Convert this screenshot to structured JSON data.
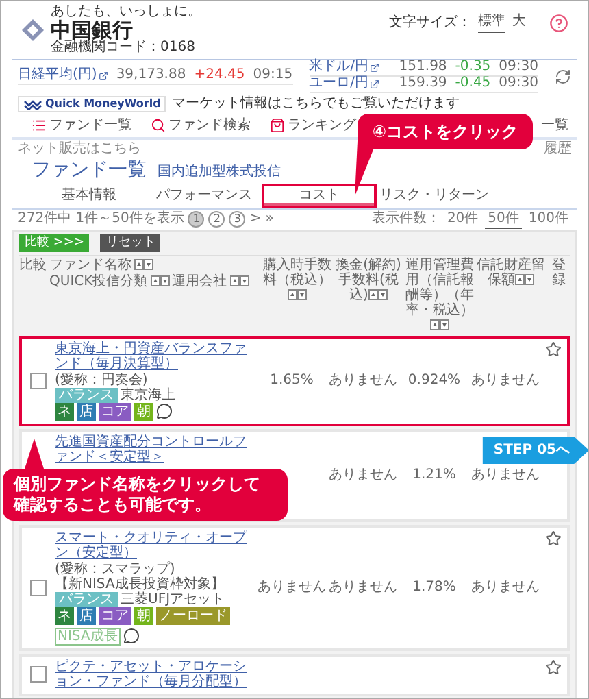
{
  "header": {
    "slogan": "あしたも、いっしょに。",
    "bank_name": "中国銀行",
    "bank_code": "金融機関コード：0168",
    "font_size_label": "文字サイズ：",
    "font_sizes": [
      {
        "label": "標準",
        "selected": true
      },
      {
        "label": "大",
        "selected": false
      }
    ]
  },
  "market": {
    "left": [
      {
        "name": "日経平均(円)",
        "value": "39,173.88",
        "change": "+24.45",
        "color": "#e53935",
        "time": "09:15"
      }
    ],
    "right": [
      {
        "name": "米ドル/円",
        "value": "151.98",
        "change": "-0.35",
        "color": "#3aa845",
        "time": "09:30"
      },
      {
        "name": "ユーロ/円",
        "value": "159.39",
        "change": "-0.45",
        "color": "#3aa845",
        "time": "09:30"
      }
    ]
  },
  "quick_banner": {
    "logo": "Quick MoneyWorld",
    "text": "マーケット情報はこちらでもご覧いただけます"
  },
  "nav": [
    {
      "kind": "list",
      "label": "ファンド一覧"
    },
    {
      "kind": "search",
      "label": "ファンド検索"
    },
    {
      "kind": "ranking",
      "label": "ランキング"
    },
    {
      "kind": "plain",
      "label": "一覧"
    }
  ],
  "breadcrumb": {
    "left": "ネット販売はこちら",
    "right": "履歴"
  },
  "title": {
    "main": "ファンド一覧",
    "sub": "国内追加型株式投信"
  },
  "tabs": [
    {
      "label": "基本情報",
      "selected": false,
      "highlighted": false
    },
    {
      "label": "パフォーマンス",
      "selected": false,
      "highlighted": false
    },
    {
      "label": "コスト",
      "selected": true,
      "highlighted": true
    },
    {
      "label": "リスク・リターン",
      "selected": false,
      "highlighted": false
    }
  ],
  "pagination": {
    "summary": "272件中 1件～50件を表示",
    "pages": [
      {
        "label": "1",
        "selected": true
      },
      {
        "label": "2",
        "selected": false
      },
      {
        "label": "3",
        "selected": false
      }
    ],
    "next": ">",
    "last": "»",
    "per_page_label": "表示件数：",
    "per_page": [
      {
        "label": "20件",
        "selected": false
      },
      {
        "label": "50件",
        "selected": true
      },
      {
        "label": "100件",
        "selected": false
      }
    ]
  },
  "buttons": {
    "compare": "比較 >>>",
    "reset": "リセット"
  },
  "columns": {
    "compare": "比較",
    "name": "ファンド名称",
    "category": "QUICK投信分類",
    "company": "運用会社",
    "purchase_fee": "購入時手数料（税込）",
    "redemption_fee": "換金(解約)手数料(税込)",
    "management_fee": "運用管理費用（信託報酬等）（年率・税込）",
    "reserve": "信託財産留保額",
    "favorite": "登録"
  },
  "funds": [
    {
      "name": "東京海上・円資産バランスファンド（毎月決算型）",
      "short_name": "(愛称：円奏会)",
      "category": "バランス",
      "company": "東京海上",
      "badges": [
        {
          "label": "ネ",
          "color": "#2e8540"
        },
        {
          "label": "店",
          "color": "#2f7db3"
        },
        {
          "label": "コア",
          "color": "#8a5cc2"
        },
        {
          "label": "朝",
          "color": "#74b51c"
        }
      ],
      "purchase_fee": "1.65%",
      "redemption_fee": "ありません",
      "management_fee": "0.924%",
      "reserve": "ありません",
      "checked": false,
      "favorite": false,
      "highlighted": true
    },
    {
      "name": "先進国資産配分コントロールファンド＜安定型＞",
      "redemption_fee": "ありません",
      "management_fee": "1.21%",
      "reserve": "ありません",
      "highlighted": false
    },
    {
      "name": "スマート・クオリティ・オープン（安定型）",
      "short_name": "(愛称：スマラップ)",
      "note": "【新NISA成長投資枠対象】",
      "category": "バランス",
      "company": "三菱UFJアセット",
      "badges": [
        {
          "label": "ネ",
          "color": "#2e8540"
        },
        {
          "label": "店",
          "color": "#2f7db3"
        },
        {
          "label": "コア",
          "color": "#8a5cc2"
        },
        {
          "label": "朝",
          "color": "#74b51c"
        },
        {
          "label": "ノーロード",
          "color": "#9a982a"
        },
        {
          "label": "NISA成長",
          "color": "#8cc58c",
          "outline": true
        }
      ],
      "purchase_fee": "ありません",
      "redemption_fee": "ありません",
      "management_fee": "1.78%",
      "reserve": "ありません",
      "checked": false,
      "favorite": false,
      "highlighted": false
    },
    {
      "name": "ピクテ・アセット・アロケーション・ファンド（毎月分配型）",
      "checked": false,
      "favorite": false,
      "highlighted": false
    }
  ],
  "annotations": {
    "tab_callout": "④コストをクリック",
    "row_callout": [
      "個別ファンド名称をクリックして",
      "確認することも可能です。"
    ],
    "step_link": "STEP 05へ"
  }
}
